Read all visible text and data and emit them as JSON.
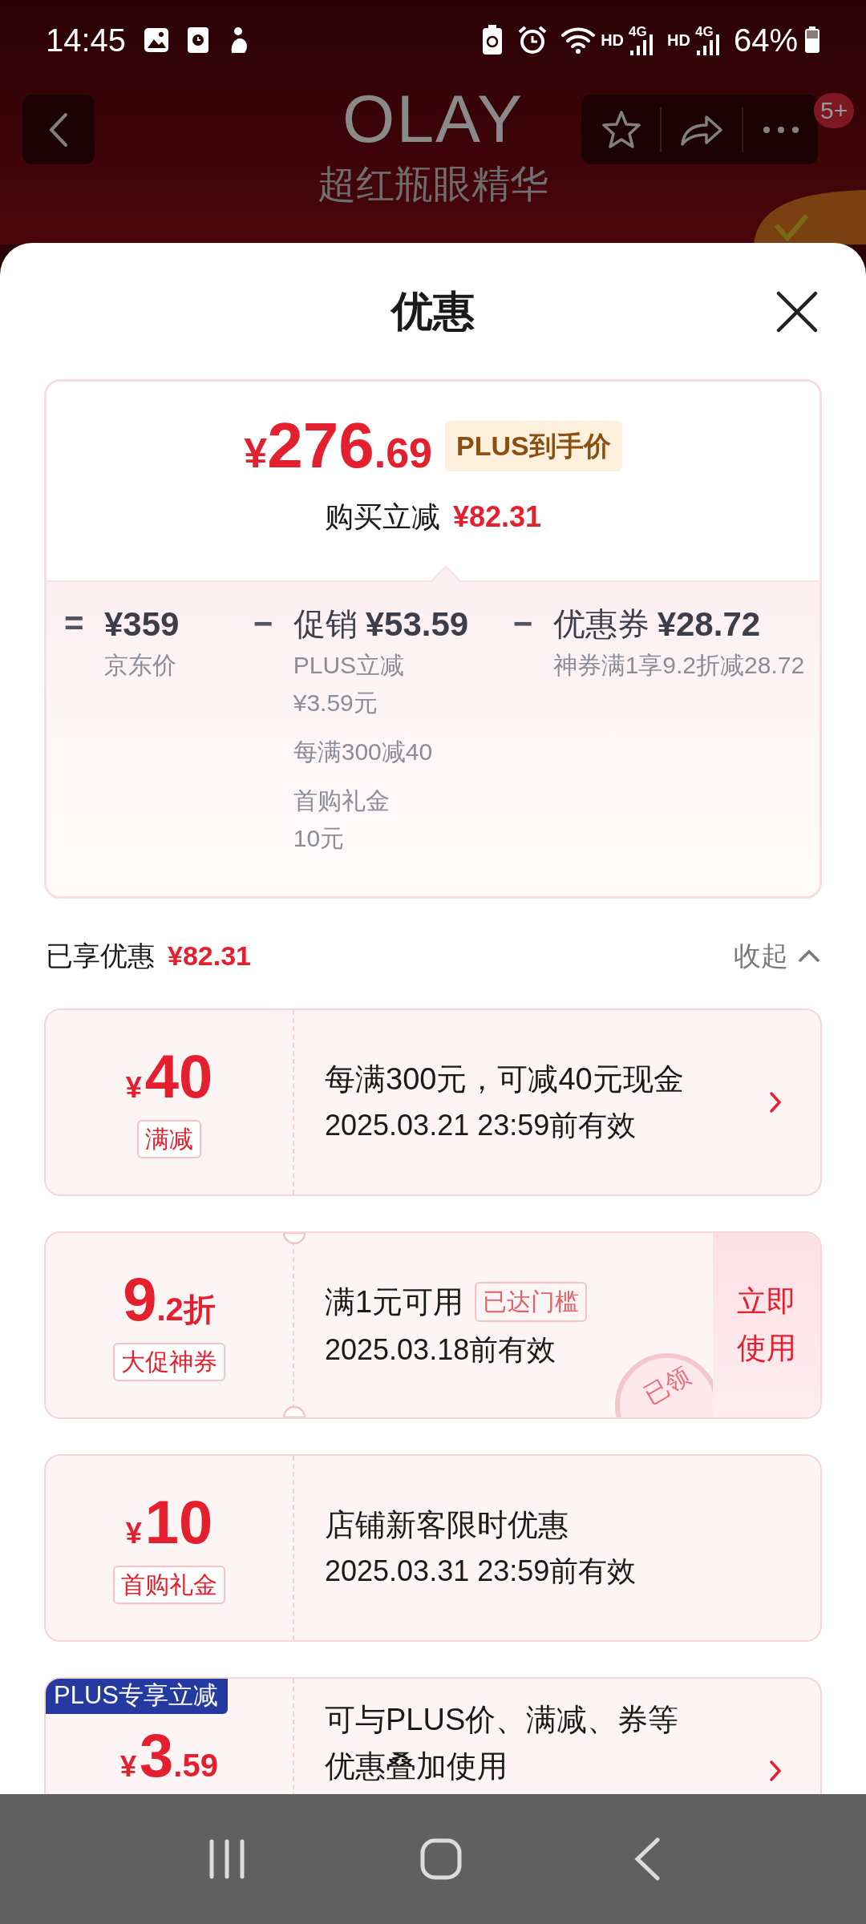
{
  "status_bar": {
    "time": "14:45",
    "networks": [
      {
        "hd": "HD",
        "gen": "4G"
      },
      {
        "hd": "HD",
        "gen": "4G"
      }
    ],
    "battery": "64%"
  },
  "header": {
    "brand": "OLAY",
    "subtitle": "超红瓶眼精华",
    "badge": "5+"
  },
  "sheet": {
    "title": "优惠"
  },
  "price_card": {
    "currency": "¥",
    "price_integer": "276",
    "price_decimal": ".69",
    "tag": "PLUS到手价",
    "reduce_label": "购买立减",
    "reduce_value": "¥82.31",
    "breakdown": [
      {
        "operator": "=",
        "amount": "¥359",
        "notes": [
          [
            "京东价"
          ]
        ]
      },
      {
        "operator": "−",
        "label": "促销",
        "amount": "¥53.59",
        "notes": [
          [
            "PLUS立减",
            "¥3.59元"
          ],
          [
            "每满300减40"
          ],
          [
            "首购礼金",
            "10元"
          ]
        ]
      },
      {
        "operator": "−",
        "label": "优惠券",
        "amount": "¥28.72",
        "notes": [
          [
            "神券满1享9.2折减28.72"
          ]
        ]
      }
    ]
  },
  "summary": {
    "label": "已享优惠",
    "value": "¥82.31",
    "toggle": "收起"
  },
  "coupons": [
    {
      "kind": "chevron",
      "currency": "¥",
      "integer": "40",
      "tag": "满减",
      "description": "每满300元，可减40元现金",
      "validity": "2025.03.21 23:59前有效",
      "notched": false
    },
    {
      "kind": "button",
      "integer": "9",
      "decimal": ".2",
      "suffix": "折",
      "tag": "大促神券",
      "description": "满1元可用",
      "badge": "已达门槛",
      "validity": "2025.03.18前有效",
      "action_label": "立即使用",
      "stamp": "已领",
      "notched": true
    },
    {
      "kind": "plain",
      "currency": "¥",
      "integer": "10",
      "tag": "首购礼金",
      "description": "店铺新客限时优惠",
      "validity": "2025.03.31 23:59前有效",
      "notched": false
    },
    {
      "kind": "chevron",
      "currency": "¥",
      "integer": "3",
      "decimal": ".59",
      "corner_label": "PLUS专享立减",
      "description": "可与PLUS价、满减、券等优惠叠加使用",
      "notched": false
    }
  ]
}
